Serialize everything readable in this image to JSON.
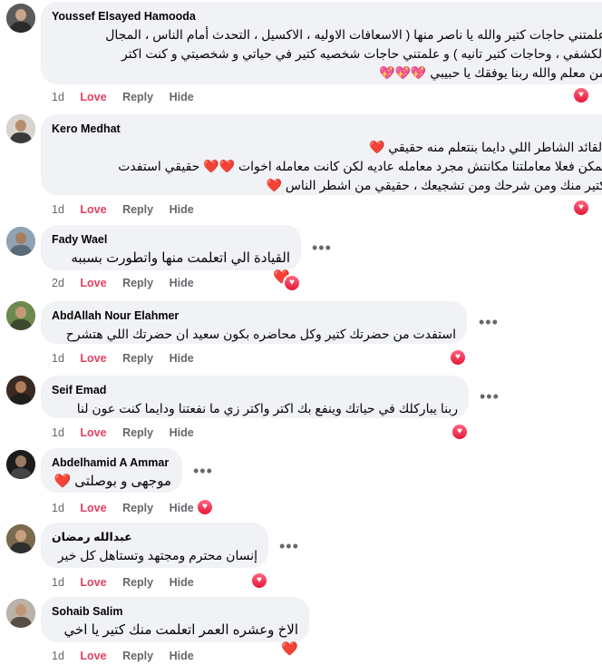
{
  "action_labels": {
    "love": "Love",
    "reply": "Reply",
    "hide": "Hide"
  },
  "colors": {
    "love": "#e4405f",
    "bubble": "#f0f2f5",
    "meta": "#65676b",
    "heart": "#e41e3f"
  },
  "comments": [
    {
      "name": "Youssef Elsayed Hamooda",
      "lines": [
        "علمتني حاجات كتير والله يا ناصر منها ( الاسعافات الاوليه ، الاكسيل ، التحدث أمام الناس ، المجال",
        "الكشفي ، وحاجات كتير تانيه ) و علمتني حاجات شخصيه كتير في حياتي و شخصيتي و كنت اكتر",
        "من معلم والله ربنا يوفقك يا حبيبي 💖💖💖"
      ],
      "time": "1d",
      "reaction_icon": "heart-reaction-icon"
    },
    {
      "name": "Kero Medhat",
      "lines": [
        "القائد الشاطر اللي دايما بنتعلم منه حقيقي ❤️",
        "يمكن فعلا معاملتنا مكانتش مجرد معامله عاديه لكن كانت معامله اخوات ❤️❤️ حقيقي استفدت",
        "كتير منك ومن شرحك ومن تشجيعك ، حقيقي من اشطر الناس ❤️"
      ],
      "time": "1d",
      "reaction_icon": "heart-reaction-icon"
    },
    {
      "name": "Fady Wael",
      "lines": [
        "القيادة الي اتعلمت منها واتطورت بسببه ❤️"
      ],
      "time": "2d",
      "reaction_icon": "heart-reaction-icon"
    },
    {
      "name": "AbdAllah Nour Elahmer",
      "lines": [
        "استفدت من حضرتك كتير وكل محاضره بكون سعيد ان حضرتك اللي هتشرح"
      ],
      "time": "1d",
      "reaction_icon": "heart-reaction-icon"
    },
    {
      "name": "Seif Emad",
      "lines": [
        "ربنا يباركلك في حياتك وينفع بك اكتر واكتر زي ما نفعتنا ودايما كنت عون لنا"
      ],
      "time": "1d",
      "reaction_icon": "heart-reaction-icon"
    },
    {
      "name": "Abdelhamid A Ammar",
      "lines": [
        "موجهى و بوصلتى ❤️"
      ],
      "time": "1d",
      "reaction_icon": "heart-reaction-icon"
    },
    {
      "name": "عبدالله رمضان",
      "lines": [
        "إنسان محترم ومجتهد وتستاهل كل خير"
      ],
      "time": "1d",
      "reaction_icon": "heart-reaction-icon"
    },
    {
      "name": "Sohaib Salim",
      "lines": [
        "الاخ وعشره العمر اتعلمت منك كتير يا اخي ❤️"
      ],
      "time": "1d",
      "reaction_icon": "heart-reaction-icon"
    }
  ],
  "more_icon": "more-options-icon"
}
